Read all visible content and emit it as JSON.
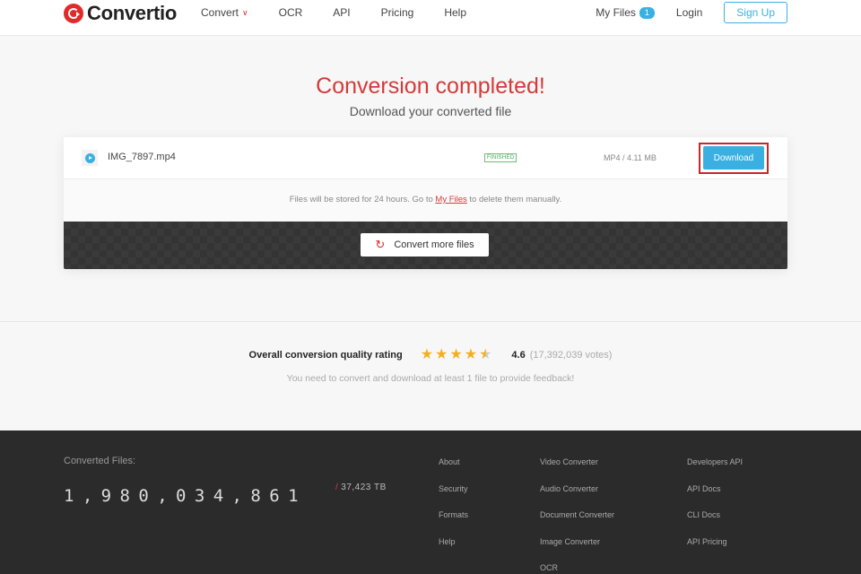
{
  "header": {
    "logo_text": "Convertio",
    "nav": [
      {
        "label": "Convert",
        "has_dropdown": true
      },
      {
        "label": "OCR"
      },
      {
        "label": "API"
      },
      {
        "label": "Pricing"
      },
      {
        "label": "Help"
      }
    ],
    "my_files_label": "My Files",
    "my_files_count": "1",
    "login_label": "Login",
    "signup_label": "Sign Up"
  },
  "main": {
    "title": "Conversion completed!",
    "subtitle": "Download your converted file"
  },
  "file": {
    "name": "IMG_7897.mp4",
    "status": "FINISHED",
    "meta": "MP4 / 4.11 MB",
    "download_label": "Download"
  },
  "note": {
    "before": "Files will be stored for 24 hours. Go to ",
    "link": "My Files",
    "after": " to delete them manually."
  },
  "convert_more_label": "Convert more files",
  "rating": {
    "label": "Overall conversion quality rating",
    "stars": 4.6,
    "value": "4.6",
    "votes": "(17,392,039 votes)",
    "feedback": "You need to convert and download at least 1 file to provide feedback!"
  },
  "footer": {
    "converted_label": "Converted Files:",
    "converted_count": "1,980,034,861",
    "tb_slash": "/",
    "tb_value": "37,423 TB",
    "col1": [
      "About",
      "Security",
      "Formats",
      "Help"
    ],
    "col2": [
      "Video Converter",
      "Audio Converter",
      "Document Converter",
      "Image Converter",
      "OCR"
    ],
    "col3": [
      "Developers API",
      "API Docs",
      "CLI Docs",
      "API Pricing"
    ]
  },
  "colors": {
    "brand_red": "#e02b2b",
    "accent_blue": "#3ab0e2",
    "title_red": "#d43a3a",
    "star_gold": "#f2b01e",
    "footer_bg": "#2b2b2b"
  },
  "icons": {
    "logo": "convertio-logo-icon",
    "dropdown": "chevron-down-icon",
    "file": "play-icon",
    "refresh": "refresh-icon",
    "star": "star-icon"
  }
}
